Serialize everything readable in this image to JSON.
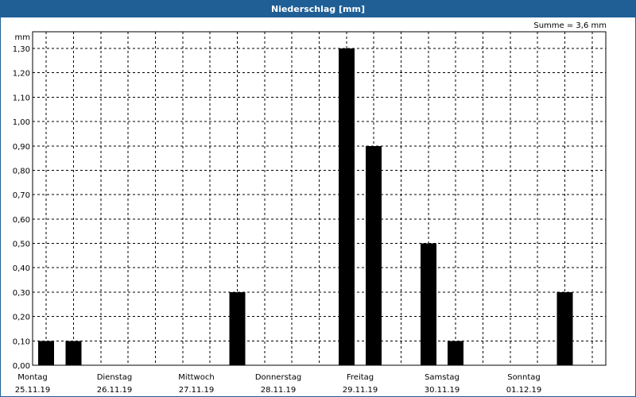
{
  "window": {
    "title": "Niederschlag [mm]"
  },
  "summary": "Summe = 3,6 mm",
  "colors": {
    "title_bar": "#1f5f95",
    "bars": "#000000",
    "grid": "#000000"
  },
  "chart_data": {
    "type": "bar",
    "title": "Niederschlag [mm]",
    "ylabel": "mm",
    "ylim": [
      0,
      1.3
    ],
    "yticks": [
      "0,00",
      "0,10",
      "0,20",
      "0,30",
      "0,40",
      "0,50",
      "0,60",
      "0,70",
      "0,80",
      "0,90",
      "1,00",
      "1,10",
      "1,20",
      "1,30"
    ],
    "days": [
      {
        "name": "Montag",
        "date": "25.11.19"
      },
      {
        "name": "Dienstag",
        "date": "26.11.19"
      },
      {
        "name": "Mittwoch",
        "date": "27.11.19"
      },
      {
        "name": "Donnerstag",
        "date": "28.11.19"
      },
      {
        "name": "Freitag",
        "date": "29.11.19"
      },
      {
        "name": "Samstag",
        "date": "30.11.19"
      },
      {
        "name": "Sonntag",
        "date": "01.12.19"
      }
    ],
    "bars": [
      {
        "day": 0,
        "part": 0,
        "value": 0.1
      },
      {
        "day": 0,
        "part": 1,
        "value": 0.1
      },
      {
        "day": 2,
        "part": 1,
        "value": 0.3
      },
      {
        "day": 3,
        "part": 2,
        "value": 1.3
      },
      {
        "day": 4,
        "part": 0,
        "value": 0.9
      },
      {
        "day": 4,
        "part": 2,
        "value": 0.5
      },
      {
        "day": 5,
        "part": 0,
        "value": 0.1
      },
      {
        "day": 6,
        "part": 1,
        "value": 0.3
      }
    ],
    "grid": true,
    "summary": "Summe = 3,6 mm"
  }
}
